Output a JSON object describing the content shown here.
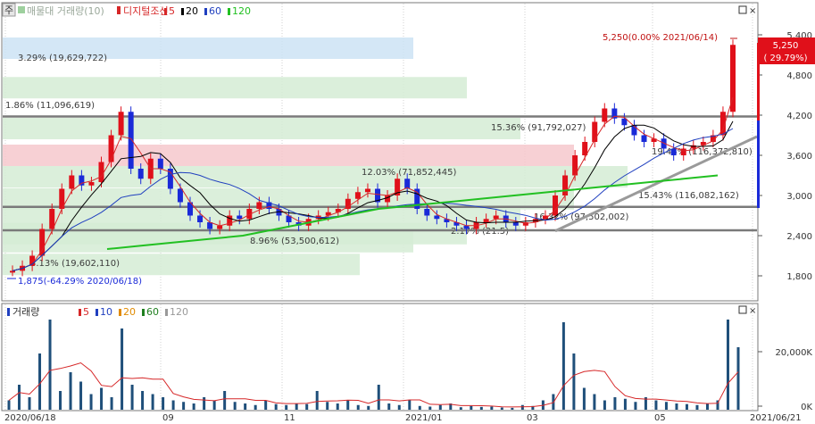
{
  "window": {
    "price_panel_tag": "주",
    "price_legend": {
      "title": "매물대 거래량(10)",
      "chart_type": "디지털조선",
      "ma_items": [
        {
          "label": "5",
          "color": "#d62728"
        },
        {
          "label": "20",
          "color": "#000000"
        },
        {
          "label": "60",
          "color": "#1f3fbf"
        },
        {
          "label": "120",
          "color": "#22c022"
        }
      ]
    },
    "volume_legend": {
      "title": "거래량",
      "ma_items": [
        {
          "label": "5",
          "color": "#d62728"
        },
        {
          "label": "10",
          "color": "#1f3fbf"
        },
        {
          "label": "20",
          "color": "#e08a00"
        },
        {
          "label": "60",
          "color": "#1f7f1f"
        },
        {
          "label": "120",
          "color": "#999999"
        }
      ]
    }
  },
  "chart_data": [
    {
      "type": "candlestick",
      "title": "디지털조선",
      "ylim": [
        1300,
        5500
      ],
      "y_ticks": [
        "5,400",
        "4,800",
        "4,200",
        "3,600",
        "3,000",
        "2,400",
        "1,800"
      ],
      "x_ticks": [
        "2020/06/18",
        "09",
        "11",
        "2021/01",
        "03",
        "05",
        "2021/06/21"
      ],
      "current_price": {
        "value": "5,250",
        "change": "( 29.79%)"
      },
      "high_annotation": "5,250(0.00% 2021/06/14)",
      "low_annotation": "1,875(-64.29% 2020/06/18)",
      "volume_profile": [
        {
          "label": "3.29% (19,629,722)",
          "level": 5200
        },
        {
          "label": "1.86% (11,096,619)",
          "level": 4610
        },
        {
          "label": "15.36% (91,792,027)",
          "level": 4000
        },
        {
          "label": "19.48% (116,372,810)",
          "level": 3600
        },
        {
          "label": "12.03% (71,852,445)",
          "level": 3280
        },
        {
          "label": "15.43% (116,082,162)",
          "level": 2950
        },
        {
          "label": "16.32% (97,502,002)",
          "level": 2650
        },
        {
          "label": "2.17% (21.5)",
          "level": 2430
        },
        {
          "label": "8.96% (53,500,612)",
          "level": 2310
        },
        {
          "label": "3.13% (19,602,110)",
          "level": 1970
        }
      ],
      "support_resistance": [
        4180,
        2830,
        2480
      ],
      "trendline": {
        "from": [
          120,
          2470
        ],
        "to": [
          157,
          3880
        ]
      },
      "prices": [
        1875,
        1950,
        2100,
        2500,
        2800,
        3100,
        3300,
        3150,
        3200,
        3500,
        3900,
        4250,
        3400,
        3250,
        3550,
        3400,
        3100,
        2900,
        2700,
        2600,
        2500,
        2550,
        2700,
        2650,
        2800,
        2900,
        2800,
        2700,
        2600,
        2550,
        2650,
        2700,
        2750,
        2800,
        2950,
        3050,
        3100,
        2900,
        3000,
        3250,
        3100,
        2800,
        2700,
        2650,
        2600,
        2550,
        2500,
        2600,
        2650,
        2700,
        2600,
        2550,
        2600,
        2650,
        2700,
        3000,
        3300,
        3600,
        3800,
        4100,
        4300,
        4150,
        4050,
        3900,
        3800,
        3850,
        3700,
        3600,
        3700,
        3750,
        3800,
        3900,
        4250,
        5250
      ],
      "ma120": [
        2200,
        2250,
        2300,
        2350,
        2400,
        2500,
        2600,
        2700,
        2800,
        2850,
        2900,
        2950,
        3000,
        3050,
        3100,
        3150,
        3200,
        3250,
        3300
      ],
      "volume": {
        "ylim": [
          0,
          36000
        ],
        "y_ticks": [
          "20,000K",
          "0K"
        ],
        "bars": [
          3000,
          8000,
          4000,
          18000,
          30000,
          6000,
          12000,
          9000,
          5000,
          7000,
          4000,
          26000,
          8000,
          6000,
          5000,
          4000,
          3000,
          2500,
          2000,
          4000,
          3000,
          6000,
          2500,
          2000,
          1500,
          3000,
          1800,
          1500,
          2000,
          1800,
          6000,
          2500,
          2000,
          3000,
          1500,
          1200,
          8000,
          2000,
          1500,
          3000,
          1200,
          1000,
          1500,
          2000,
          800,
          1200,
          900,
          1000,
          700,
          600,
          1500,
          1200,
          3000,
          5000,
          28000,
          18000,
          7000,
          5000,
          3000,
          4000,
          3500,
          2500,
          4000,
          3000,
          2500,
          2000,
          1800,
          1500,
          2000,
          3000,
          34000,
          20000
        ]
      }
    }
  ]
}
